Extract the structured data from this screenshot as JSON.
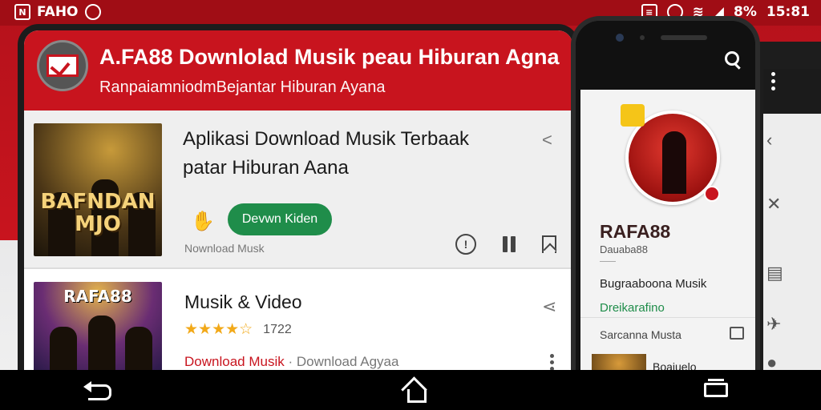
{
  "status_bar": {
    "left_text": "FAHO",
    "battery": "8%",
    "time": "15:81"
  },
  "app": {
    "title": "A.FA88 Downlolad Musik peau Hiburan Agna",
    "subtitle": "RanpaiamniodmBejantar Hiburan Ayana"
  },
  "cards": [
    {
      "album_text": "BAFNDAN MJO",
      "title": "Aplikasi Download Musik Terbaak patar Hiburan Aana",
      "button": "Devwn Kiden",
      "caption": "Nownload Musk"
    },
    {
      "album_text": "RAFA88",
      "title": "Musik & Video",
      "stars": "★★★★☆",
      "rating": "1722",
      "link_red": "Download Musik",
      "link_gray": "· Download Agyaa"
    }
  ],
  "side_panel": {
    "name": "RAFA88",
    "sub": "Dauaba88",
    "line1": "Bugraaboona Musik",
    "line2": "Dreikarafino",
    "line3": "Sarcanna Musta",
    "mini_title": "Boaiuelo"
  },
  "colors": {
    "brand_red": "#c8141e",
    "download_green": "#1f8d4a",
    "star_gold": "#f2a919"
  }
}
